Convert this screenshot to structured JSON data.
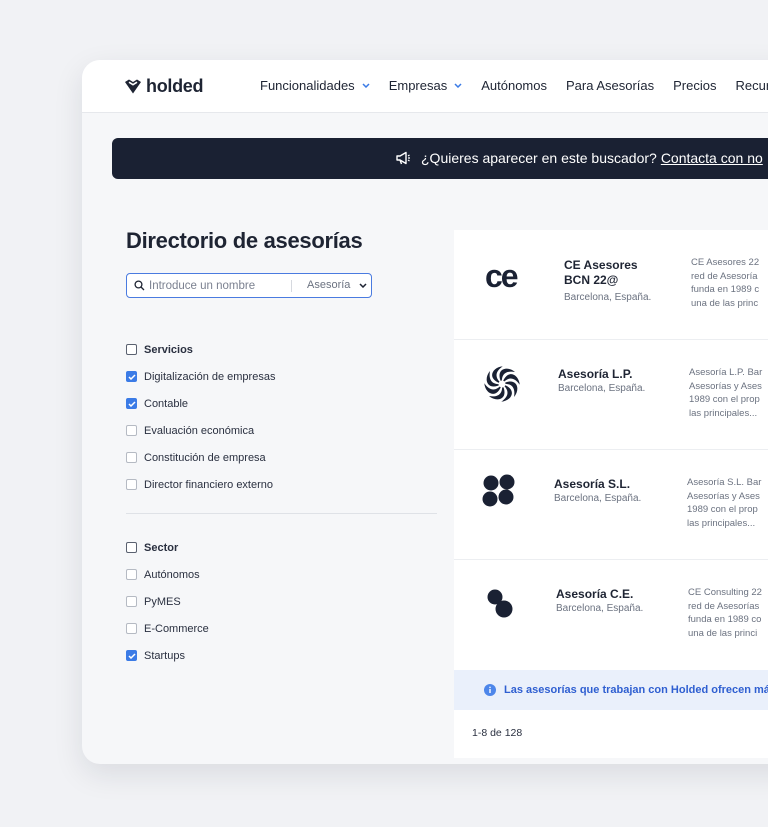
{
  "brand": {
    "name": "holded"
  },
  "nav": {
    "items": [
      {
        "label": "Funcionalidades",
        "dropdown": true
      },
      {
        "label": "Empresas",
        "dropdown": true
      },
      {
        "label": "Autónomos",
        "dropdown": false
      },
      {
        "label": "Para Asesorías",
        "dropdown": false
      },
      {
        "label": "Precios",
        "dropdown": false
      },
      {
        "label": "Recurso",
        "dropdown": false
      }
    ]
  },
  "banner": {
    "text": "¿Quieres aparecer en este buscador?",
    "link": "Contacta con no",
    "icon": "megaphone-icon"
  },
  "page": {
    "title": "Directorio de asesorías"
  },
  "search": {
    "placeholder": "Introduce un nombre",
    "select_value": "Asesoría"
  },
  "filters": {
    "servicios": {
      "title": "Servicios",
      "options": [
        {
          "label": "Digitalización de empresas",
          "checked": true
        },
        {
          "label": "Contable",
          "checked": true
        },
        {
          "label": "Evaluación económica",
          "checked": false
        },
        {
          "label": "Constitución de empresa",
          "checked": false
        },
        {
          "label": "Director financiero externo",
          "checked": false
        }
      ]
    },
    "sector": {
      "title": "Sector",
      "options": [
        {
          "label": "Autónomos",
          "checked": false
        },
        {
          "label": "PyMES",
          "checked": false
        },
        {
          "label": "E-Commerce",
          "checked": false
        },
        {
          "label": "Startups",
          "checked": true
        }
      ]
    }
  },
  "results": [
    {
      "logo": "ce",
      "name": "CE Asesores BCN 22@",
      "location": "Barcelona, España.",
      "description": "CE Asesores 22\nred de Asesoría\nfunda en 1989 c\nuna de las princ"
    },
    {
      "logo": "swirl",
      "name": "Asesoría L.P.",
      "location": "Barcelona, España.",
      "description": "Asesoría L.P. Bar\nAsesorías y Ases\n1989 con el prop\nlas principales..."
    },
    {
      "logo": "dots4",
      "name": "Asesoría S.L.",
      "location": "Barcelona, España.",
      "description": "Asesoría S.L. Bar\nAsesorías y Ases\n1989 con el prop\nlas principales..."
    },
    {
      "logo": "dots2",
      "name": "Asesoría C.E.",
      "location": "Barcelona, España.",
      "description": "CE Consulting 22\nred de Asesorías\nfunda en 1989 co\nuna de las princi"
    }
  ],
  "info": {
    "text": "Las asesorías que trabajan con Holded ofrecen más"
  },
  "pagination": {
    "label": "1-8 de 128"
  },
  "colors": {
    "accent": "#3b7be6",
    "banner_bg": "#1a2133",
    "info_bg": "#eaf0fb",
    "info_text": "#2f5fd1"
  }
}
